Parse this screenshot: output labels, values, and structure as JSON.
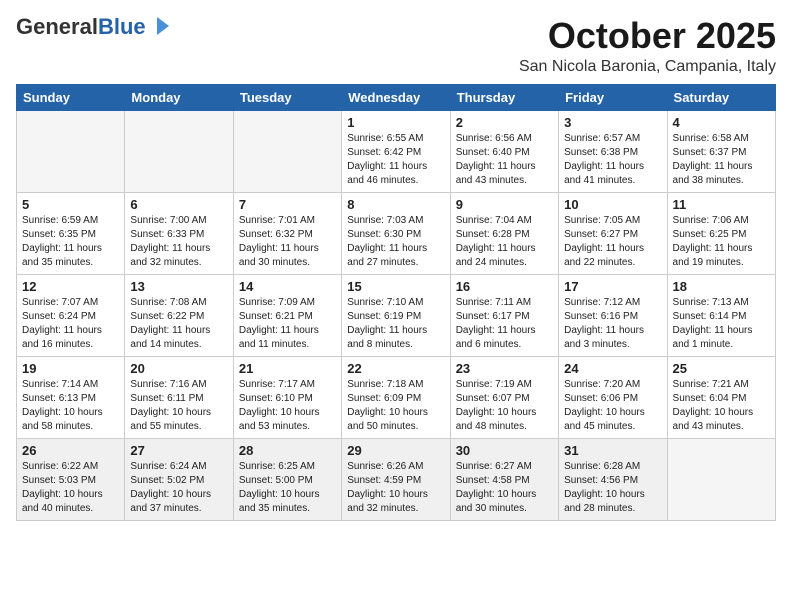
{
  "header": {
    "logo_general": "General",
    "logo_blue": "Blue",
    "title": "October 2025",
    "subtitle": "San Nicola Baronia, Campania, Italy"
  },
  "days_of_week": [
    "Sunday",
    "Monday",
    "Tuesday",
    "Wednesday",
    "Thursday",
    "Friday",
    "Saturday"
  ],
  "weeks": [
    [
      {
        "day": "",
        "empty": true
      },
      {
        "day": "",
        "empty": true
      },
      {
        "day": "",
        "empty": true
      },
      {
        "day": "1",
        "info": "Sunrise: 6:55 AM\nSunset: 6:42 PM\nDaylight: 11 hours\nand 46 minutes."
      },
      {
        "day": "2",
        "info": "Sunrise: 6:56 AM\nSunset: 6:40 PM\nDaylight: 11 hours\nand 43 minutes."
      },
      {
        "day": "3",
        "info": "Sunrise: 6:57 AM\nSunset: 6:38 PM\nDaylight: 11 hours\nand 41 minutes."
      },
      {
        "day": "4",
        "info": "Sunrise: 6:58 AM\nSunset: 6:37 PM\nDaylight: 11 hours\nand 38 minutes."
      }
    ],
    [
      {
        "day": "5",
        "info": "Sunrise: 6:59 AM\nSunset: 6:35 PM\nDaylight: 11 hours\nand 35 minutes."
      },
      {
        "day": "6",
        "info": "Sunrise: 7:00 AM\nSunset: 6:33 PM\nDaylight: 11 hours\nand 32 minutes."
      },
      {
        "day": "7",
        "info": "Sunrise: 7:01 AM\nSunset: 6:32 PM\nDaylight: 11 hours\nand 30 minutes."
      },
      {
        "day": "8",
        "info": "Sunrise: 7:03 AM\nSunset: 6:30 PM\nDaylight: 11 hours\nand 27 minutes."
      },
      {
        "day": "9",
        "info": "Sunrise: 7:04 AM\nSunset: 6:28 PM\nDaylight: 11 hours\nand 24 minutes."
      },
      {
        "day": "10",
        "info": "Sunrise: 7:05 AM\nSunset: 6:27 PM\nDaylight: 11 hours\nand 22 minutes."
      },
      {
        "day": "11",
        "info": "Sunrise: 7:06 AM\nSunset: 6:25 PM\nDaylight: 11 hours\nand 19 minutes."
      }
    ],
    [
      {
        "day": "12",
        "info": "Sunrise: 7:07 AM\nSunset: 6:24 PM\nDaylight: 11 hours\nand 16 minutes."
      },
      {
        "day": "13",
        "info": "Sunrise: 7:08 AM\nSunset: 6:22 PM\nDaylight: 11 hours\nand 14 minutes."
      },
      {
        "day": "14",
        "info": "Sunrise: 7:09 AM\nSunset: 6:21 PM\nDaylight: 11 hours\nand 11 minutes."
      },
      {
        "day": "15",
        "info": "Sunrise: 7:10 AM\nSunset: 6:19 PM\nDaylight: 11 hours\nand 8 minutes."
      },
      {
        "day": "16",
        "info": "Sunrise: 7:11 AM\nSunset: 6:17 PM\nDaylight: 11 hours\nand 6 minutes."
      },
      {
        "day": "17",
        "info": "Sunrise: 7:12 AM\nSunset: 6:16 PM\nDaylight: 11 hours\nand 3 minutes."
      },
      {
        "day": "18",
        "info": "Sunrise: 7:13 AM\nSunset: 6:14 PM\nDaylight: 11 hours\nand 1 minute."
      }
    ],
    [
      {
        "day": "19",
        "info": "Sunrise: 7:14 AM\nSunset: 6:13 PM\nDaylight: 10 hours\nand 58 minutes."
      },
      {
        "day": "20",
        "info": "Sunrise: 7:16 AM\nSunset: 6:11 PM\nDaylight: 10 hours\nand 55 minutes."
      },
      {
        "day": "21",
        "info": "Sunrise: 7:17 AM\nSunset: 6:10 PM\nDaylight: 10 hours\nand 53 minutes."
      },
      {
        "day": "22",
        "info": "Sunrise: 7:18 AM\nSunset: 6:09 PM\nDaylight: 10 hours\nand 50 minutes."
      },
      {
        "day": "23",
        "info": "Sunrise: 7:19 AM\nSunset: 6:07 PM\nDaylight: 10 hours\nand 48 minutes."
      },
      {
        "day": "24",
        "info": "Sunrise: 7:20 AM\nSunset: 6:06 PM\nDaylight: 10 hours\nand 45 minutes."
      },
      {
        "day": "25",
        "info": "Sunrise: 7:21 AM\nSunset: 6:04 PM\nDaylight: 10 hours\nand 43 minutes."
      }
    ],
    [
      {
        "day": "26",
        "info": "Sunrise: 6:22 AM\nSunset: 5:03 PM\nDaylight: 10 hours\nand 40 minutes.",
        "shaded": true
      },
      {
        "day": "27",
        "info": "Sunrise: 6:24 AM\nSunset: 5:02 PM\nDaylight: 10 hours\nand 37 minutes.",
        "shaded": true
      },
      {
        "day": "28",
        "info": "Sunrise: 6:25 AM\nSunset: 5:00 PM\nDaylight: 10 hours\nand 35 minutes.",
        "shaded": true
      },
      {
        "day": "29",
        "info": "Sunrise: 6:26 AM\nSunset: 4:59 PM\nDaylight: 10 hours\nand 32 minutes.",
        "shaded": true
      },
      {
        "day": "30",
        "info": "Sunrise: 6:27 AM\nSunset: 4:58 PM\nDaylight: 10 hours\nand 30 minutes.",
        "shaded": true
      },
      {
        "day": "31",
        "info": "Sunrise: 6:28 AM\nSunset: 4:56 PM\nDaylight: 10 hours\nand 28 minutes.",
        "shaded": true
      },
      {
        "day": "",
        "empty": true,
        "shaded": false
      }
    ]
  ]
}
